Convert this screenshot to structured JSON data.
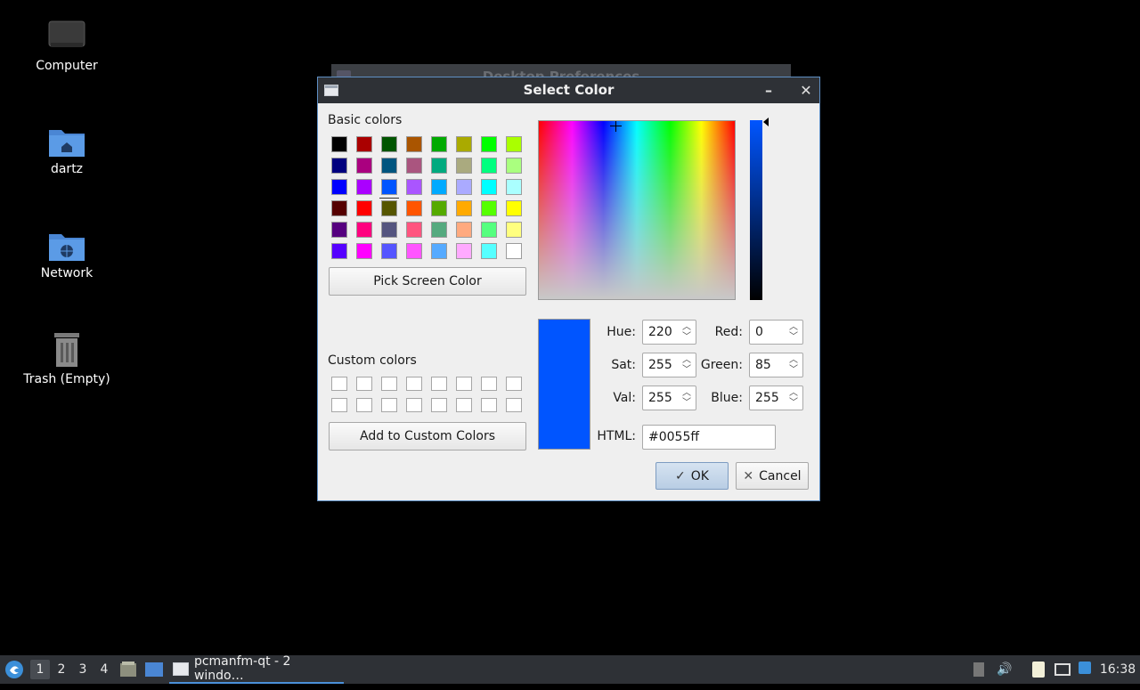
{
  "desktop": {
    "icons": [
      {
        "label": "Computer",
        "icon": "computer-icon"
      },
      {
        "label": "dartz",
        "icon": "home-folder-icon"
      },
      {
        "label": "Network",
        "icon": "network-folder-icon"
      },
      {
        "label": "Trash (Empty)",
        "icon": "trash-icon"
      }
    ]
  },
  "background_window": {
    "title": "Desktop Preferences"
  },
  "dialog": {
    "title": "Select Color",
    "basic_colors_label": "Basic colors",
    "basic_colors": [
      [
        "#000000",
        "#aa0000",
        "#005500",
        "#aa5500",
        "#00aa00",
        "#aaaa00",
        "#00ff00",
        "#aaff00"
      ],
      [
        "#00007f",
        "#aa007f",
        "#00557f",
        "#aa557f",
        "#00aa7f",
        "#aaaa7f",
        "#00ff7f",
        "#aaff7f"
      ],
      [
        "#0000ff",
        "#aa00ff",
        "#0055ff",
        "#aa55ff",
        "#00aaff",
        "#aaaaff",
        "#00ffff",
        "#aaffff"
      ],
      [
        "#550000",
        "#ff0000",
        "#555500",
        "#ff5500",
        "#55aa00",
        "#ffaa00",
        "#55ff00",
        "#ffff00"
      ],
      [
        "#55007f",
        "#ff007f",
        "#55557f",
        "#ff557f",
        "#55aa7f",
        "#ffaa7f",
        "#55ff7f",
        "#ffff7f"
      ],
      [
        "#5500ff",
        "#ff00ff",
        "#5555ff",
        "#ff55ff",
        "#55aaff",
        "#ffaaff",
        "#55ffff",
        "#ffffff"
      ]
    ],
    "selected_basic": [
      2,
      2
    ],
    "pick_screen_label": "Pick Screen Color",
    "custom_colors_label": "Custom colors",
    "add_custom_label": "Add to Custom Colors",
    "fields": {
      "hue_label": "Hue:",
      "hue": "220",
      "sat_label": "Sat:",
      "sat": "255",
      "val_label": "Val:",
      "val": "255",
      "red_label": "Red:",
      "red": "0",
      "green_label": "Green:",
      "green": "85",
      "blue_label": "Blue:",
      "blue": "255",
      "html_label": "HTML:",
      "html": "#0055ff"
    },
    "current_color": "#0055ff",
    "ok_label": "OK",
    "cancel_label": "Cancel"
  },
  "taskbar": {
    "desktops": [
      "1",
      "2",
      "3",
      "4"
    ],
    "active_desktop": "1",
    "task_label": "pcmanfm-qt - 2 windo…",
    "clock": "16:38"
  }
}
